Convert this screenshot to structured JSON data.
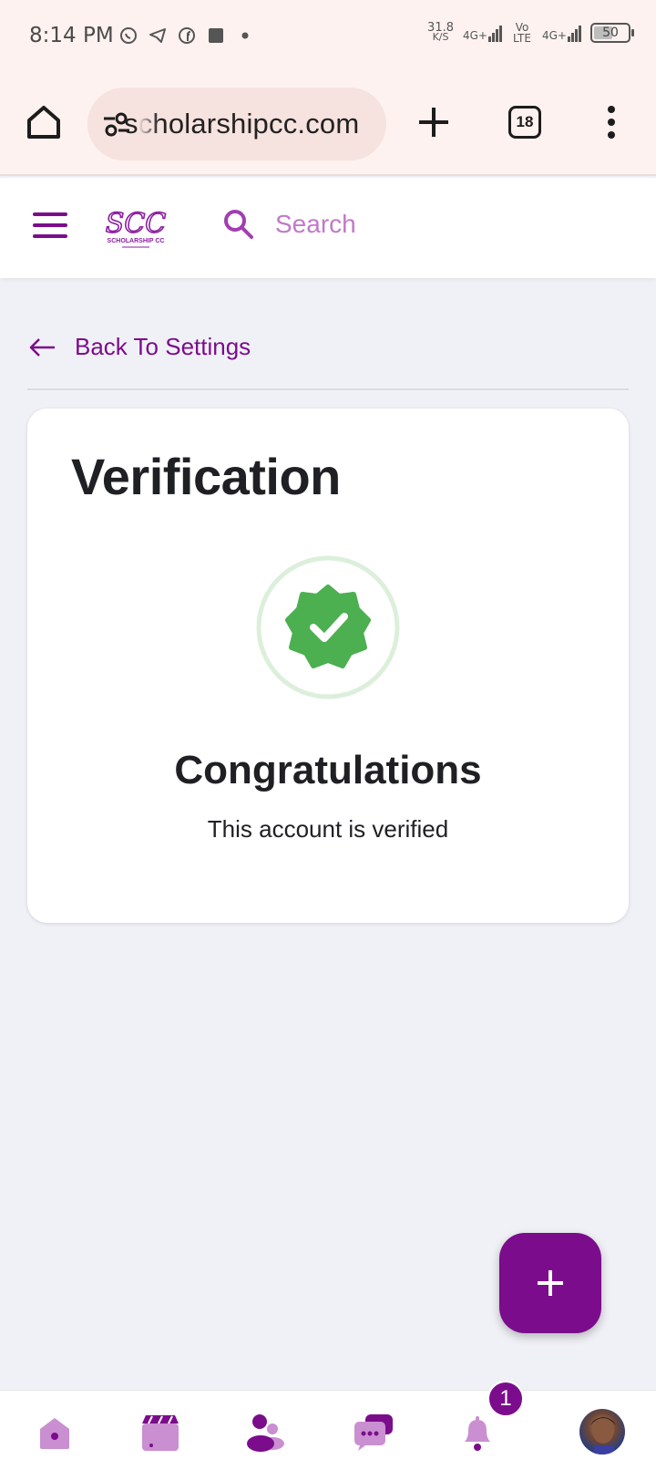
{
  "status_bar": {
    "time": "8:14 PM",
    "net_speed_value": "31.8",
    "net_speed_unit": "K/S",
    "signal_1_label": "4G+",
    "volte_label": "Vo LTE",
    "signal_2_label": "4G+",
    "battery_level": "50"
  },
  "browser": {
    "url": "scholarshipcc.com",
    "tab_count": "18"
  },
  "header": {
    "logo_text": "SCC",
    "logo_subtext": "SCHOLARSHIP CC",
    "search_placeholder": "Search"
  },
  "back_link": {
    "label": "Back To Settings"
  },
  "card": {
    "title": "Verification",
    "heading": "Congratulations",
    "message": "This account is verified"
  },
  "bottom_nav": {
    "notification_count": "1",
    "items": [
      "home-icon",
      "video-icon",
      "friends-icon",
      "chat-icon",
      "notifications-icon",
      "profile-avatar"
    ]
  },
  "colors": {
    "brand": "#7b0d8c",
    "brand_light": "#c07ac8",
    "success": "#4caf50",
    "success_ring": "#dcefdb"
  }
}
